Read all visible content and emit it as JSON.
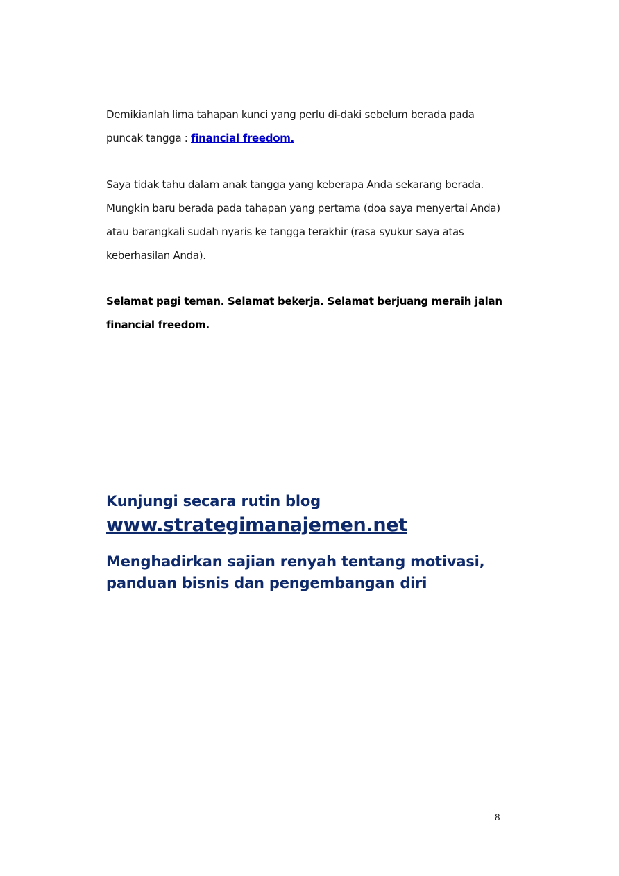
{
  "paragraph1": {
    "text": "Demikianlah lima tahapan kunci yang perlu di-daki sebelum berada pada puncak tangga : ",
    "link_text": "financial freedom."
  },
  "paragraph2": {
    "text": "Saya tidak tahu dalam anak tangga yang keberapa Anda sekarang berada. Mungkin baru berada pada tahapan yang pertama (doa saya menyertai Anda) atau barangkali sudah nyaris ke tangga terakhir (rasa syukur saya atas keberhasilan Anda)."
  },
  "paragraph3": {
    "text": "Selamat pagi teman. Selamat bekerja. Selamat berjuang meraih jalan financial freedom."
  },
  "promo": {
    "visit": "Kunjungi secara rutin blog",
    "url": "www.strategimanajemen.net",
    "description": "Menghadirkan sajian renyah tentang motivasi, panduan bisnis dan pengembangan diri"
  },
  "footer": {
    "page_number": "8"
  },
  "colors": {
    "link": "#0000cc",
    "promo": "#0f2a6b",
    "text": "#1a1a1a"
  }
}
